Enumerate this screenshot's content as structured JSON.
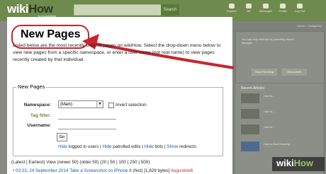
{
  "header": {
    "logo": "wiki",
    "logo_how": "How",
    "logo_tagline": "to do anything",
    "search_button": "Search",
    "nav": [
      "Explore",
      "Me",
      "Messages",
      "Profile",
      "Log Out"
    ]
  },
  "breadcrumb": "Home > Categories",
  "sidebar": {
    "box_text": "You can help wikiHow by patrolling recent changes",
    "button_1": "Start Patrolling",
    "button_2": "New Article",
    "related_heading": "Recent Articles",
    "related": [
      "How to...",
      "How to...",
      "How to...",
      "How to..."
    ],
    "related_last": "How to Start Cleaning"
  },
  "main": {
    "title": "New Pages",
    "description": "Listed below are the most recently created pages on wikiHow. Select the drop-down menu below to view new pages from a specific namespace, or enter a user name (not real name) to view pages recently created by that individual.",
    "fieldset_legend": "New Pages",
    "namespace_label": "Namespace:",
    "namespace_value": "(Main)",
    "invert_label": "Invert selection",
    "tag_label": "Tag filter:",
    "username_label": "Username:",
    "go_button": "Go",
    "links": {
      "hide": "Hide",
      "logged_in": "logged in users",
      "sep1": " | ",
      "hide2": "Hide",
      "patrolled": "patrolled edits",
      "sep2": " | ",
      "hide3": "Hide",
      "bots": "bots",
      "sep3": " | ",
      "show": "Show",
      "redirects": "redirects"
    },
    "pager": "(Latest | Earliest) View (newer 50) (older 50) (20 | 50 | 100 | 250 | 500)",
    "entry": {
      "time": "03:23, 24 September 2014",
      "page": "Take a Screenshot on iPhone 6",
      "meta": "(hist) [1,829 bytes]",
      "user": "Augustine6"
    }
  },
  "watermark": {
    "wiki": "wiki",
    "how": "How"
  },
  "colors": {
    "brand_green": "#6e8a4d",
    "highlight_red": "#c8252d",
    "link_blue": "#1a5aa8"
  }
}
